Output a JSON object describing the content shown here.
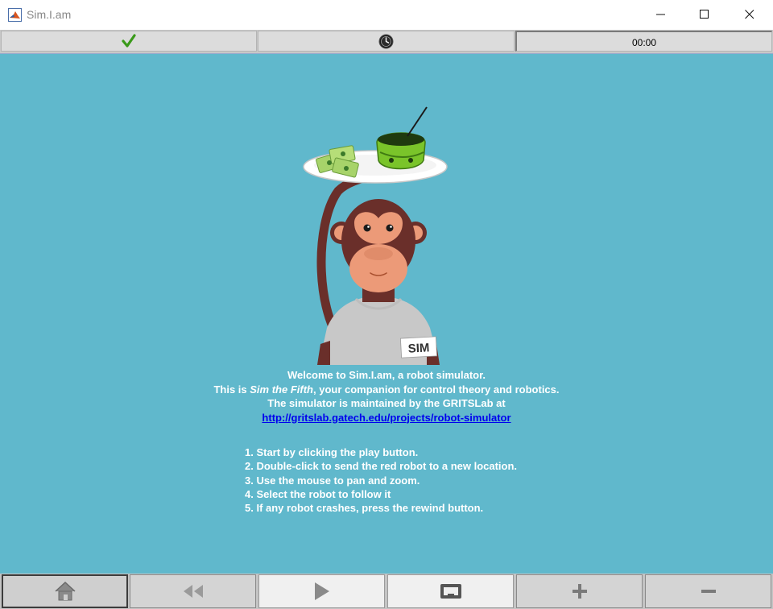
{
  "window": {
    "title": "Sim.I.am",
    "icons": [
      "matlab-icon",
      "minimize-icon",
      "maximize-icon",
      "close-icon"
    ]
  },
  "status": {
    "ok_icon": "checkmark-icon",
    "clock_icon": "clock-icon",
    "clock_value": "00:00"
  },
  "welcome": {
    "line1": "Welcome to Sim.I.am, a robot simulator.",
    "line2_pre": "This is ",
    "line2_em": "Sim the Fifth",
    "line2_post": ", your companion for control theory and robotics.",
    "line3": "The simulator is maintained by the GRITSLab at",
    "link": "http://gritslab.gatech.edu/projects/robot-simulator",
    "shirt_text": "SIM"
  },
  "instructions": [
    "1.  Start by clicking the play button.",
    "2.  Double-click to send the red robot to a new location.",
    "3.  Use the mouse to pan and zoom.",
    "4.  Select the robot to follow it",
    "5.  If any robot crashes, press the rewind button."
  ],
  "toolbar": {
    "buttons": [
      "home-icon",
      "rewind-icon",
      "play-icon",
      "follow-robot-icon",
      "zoom-in-icon",
      "zoom-out-icon"
    ]
  },
  "colors": {
    "canvas": "#60b8cc",
    "link": "#0000ee",
    "check": "#3a9a1a"
  }
}
